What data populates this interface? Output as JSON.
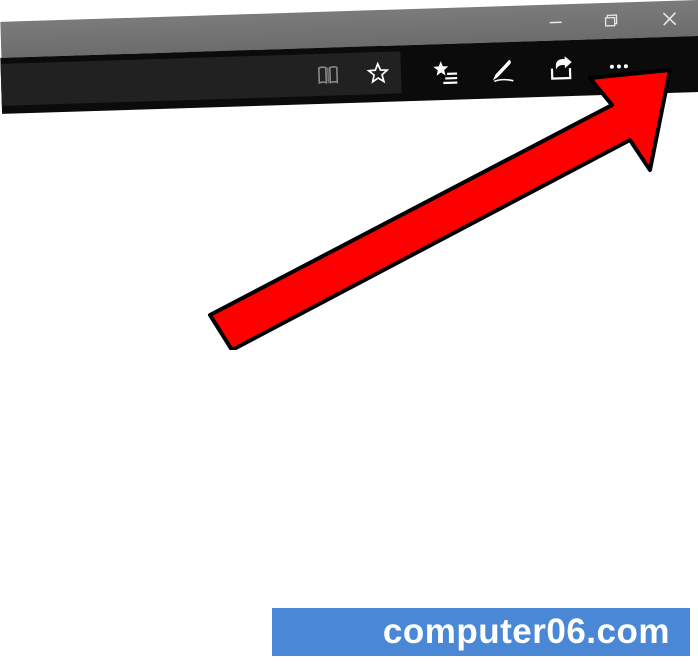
{
  "window": {
    "minimize_name": "minimize",
    "maximize_name": "restore",
    "close_name": "close"
  },
  "toolbar": {
    "reading_view_name": "reading-view",
    "favorite_name": "add-favorite",
    "hub_name": "favorites-hub",
    "notes_name": "add-notes",
    "share_name": "share",
    "more_name": "settings-and-more"
  },
  "annotation": {
    "arrow_target": "settings-and-more",
    "arrow_color": "#ff0000",
    "arrow_stroke": "#000000"
  },
  "watermark": {
    "text": "computer06.com",
    "bg": "#4a88d6",
    "fg": "#ffffff"
  }
}
